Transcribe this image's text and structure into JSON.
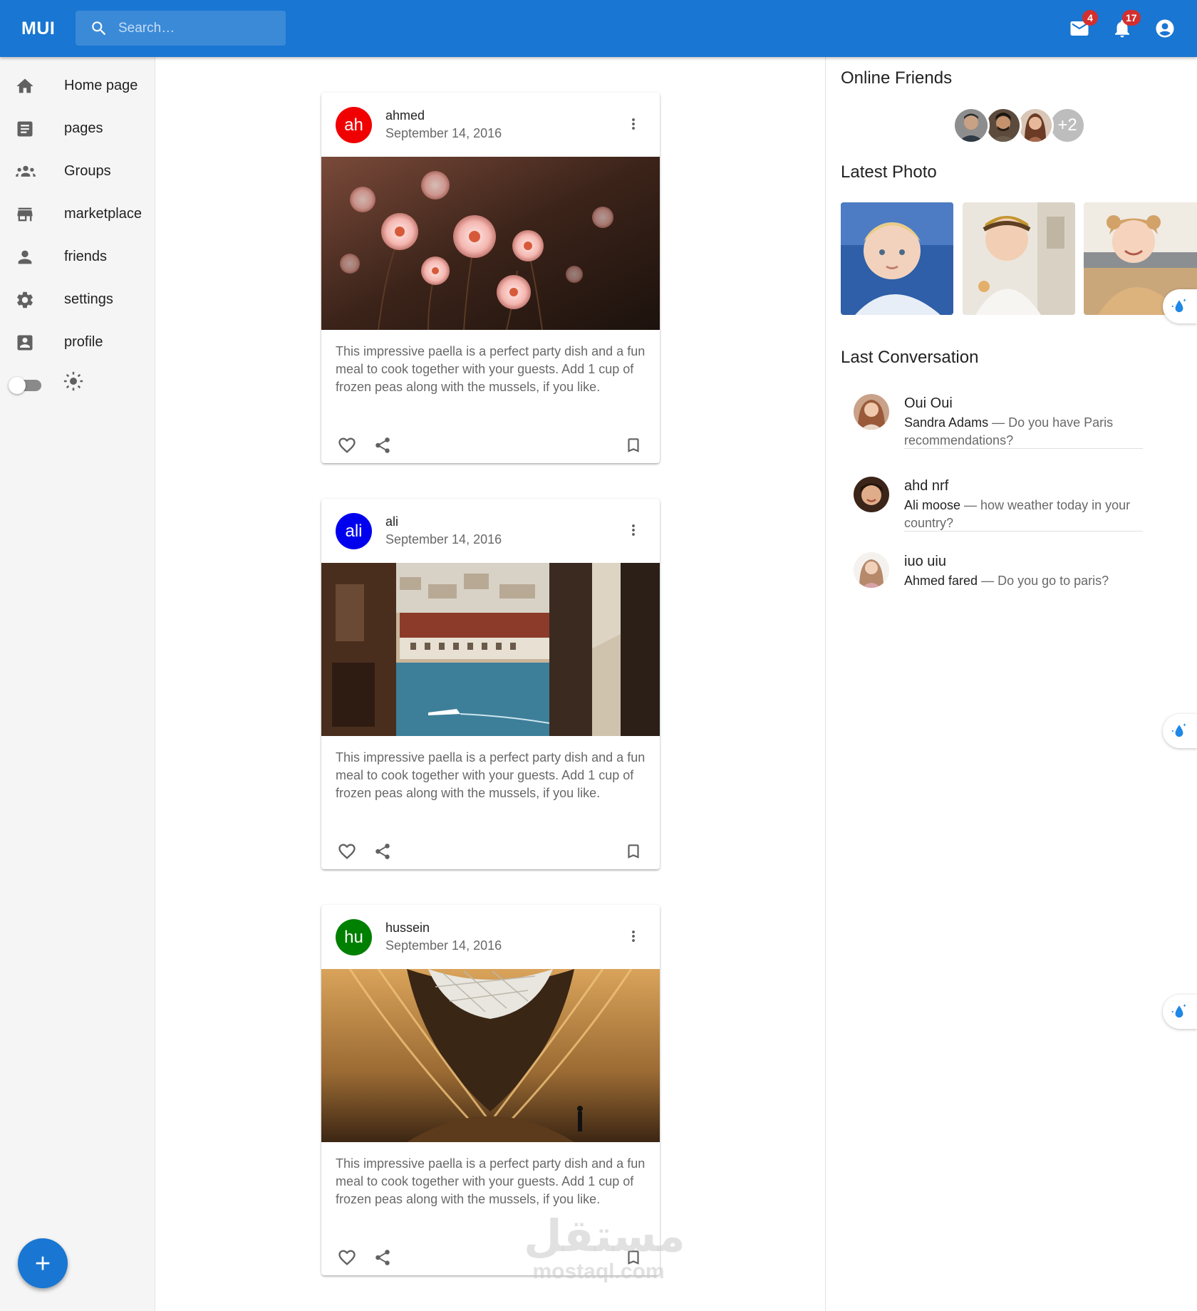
{
  "appbar": {
    "logo": "MUI",
    "search_placeholder": "Search…",
    "mail_badge": "4",
    "notifications_badge": "17",
    "color": "#1976d2"
  },
  "sidebar": {
    "items": [
      {
        "label": "Home page",
        "icon": "home-icon"
      },
      {
        "label": "pages",
        "icon": "article-icon"
      },
      {
        "label": "Groups",
        "icon": "groups-icon"
      },
      {
        "label": "marketplace",
        "icon": "storefront-icon"
      },
      {
        "label": "friends",
        "icon": "person-icon"
      },
      {
        "label": "settings",
        "icon": "settings-icon"
      },
      {
        "label": "profile",
        "icon": "account-box-icon"
      }
    ],
    "dark_mode": false
  },
  "posts": [
    {
      "avatar": "ah",
      "avatar_color": "#f00000",
      "author": "ahmed",
      "date": "September 14, 2016",
      "body": "This impressive paella is a perfect party dish and a fun meal to cook together with your guests. Add 1 cup of frozen peas along with the mussels, if you like.",
      "image": "pink-flowers-photo"
    },
    {
      "avatar": "ali",
      "avatar_color": "#0000ee",
      "author": "ali",
      "date": "September 14, 2016",
      "body": "This impressive paella is a perfect party dish and a fun meal to cook together with your guests. Add 1 cup of frozen peas along with the mussels, if you like.",
      "image": "riverside-town-photo"
    },
    {
      "avatar": "hu",
      "avatar_color": "#008000",
      "author": "hussein",
      "date": "September 14, 2016",
      "body": "This impressive paella is a perfect party dish and a fun meal to cook together with your guests. Add 1 cup of frozen peas along with the mussels, if you like.",
      "image": "wooden-atrium-photo"
    }
  ],
  "right": {
    "online_title": "Online Friends",
    "online_extra": "+2",
    "latest_title": "Latest Photo",
    "conversation_title": "Last Conversation",
    "conversations": [
      {
        "name": "Oui Oui",
        "from": "Sandra Adams",
        "message": " — Do you have Paris recommendations?"
      },
      {
        "name": "ahd nrf",
        "from": "Ali moose",
        "message": " — how weather today in your country?"
      },
      {
        "name": "iuo uiu",
        "from": "Ahmed fared",
        "message": " — Do you go to paris?"
      }
    ]
  },
  "watermark": {
    "arabic": "مستقل",
    "latin": "mostaql.com"
  }
}
